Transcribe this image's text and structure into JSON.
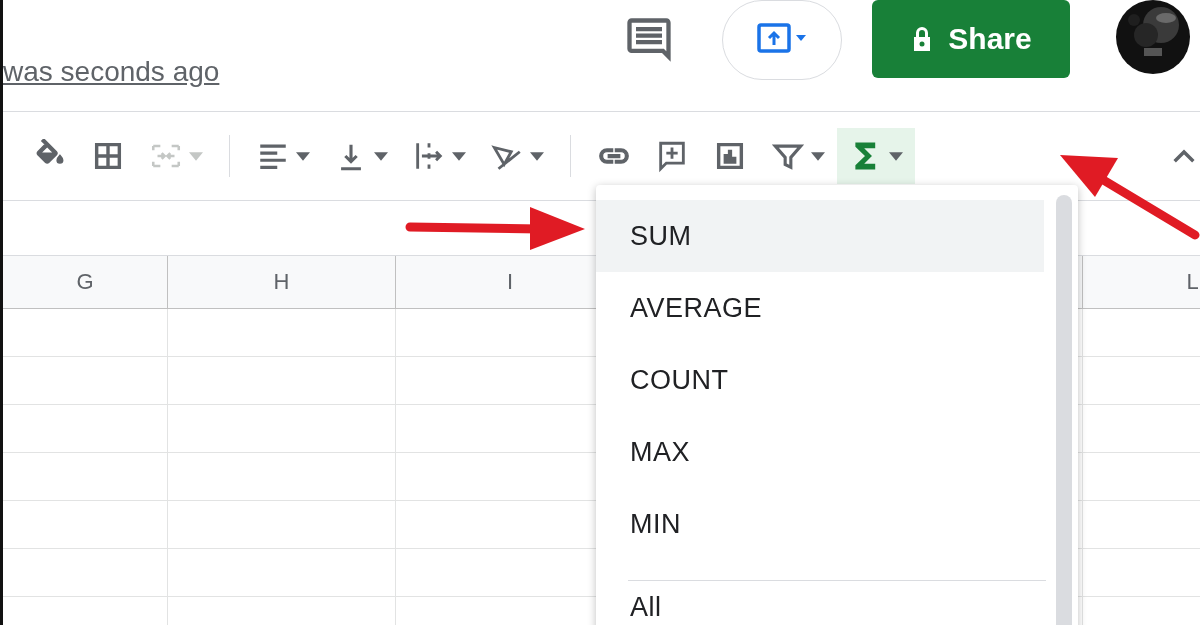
{
  "doc_status": "was seconds ago",
  "header": {
    "share_label": "Share"
  },
  "toolbar": [
    {
      "kind": "fill",
      "has_menu": false,
      "disabled": false,
      "active": false
    },
    {
      "kind": "borders",
      "has_menu": false,
      "disabled": false,
      "active": false
    },
    {
      "kind": "merge",
      "has_menu": true,
      "disabled": true,
      "active": false
    },
    {
      "kind": "separator"
    },
    {
      "kind": "halign",
      "has_menu": true,
      "disabled": false,
      "active": false
    },
    {
      "kind": "valign",
      "has_menu": true,
      "disabled": false,
      "active": false
    },
    {
      "kind": "wrap",
      "has_menu": true,
      "disabled": false,
      "active": false
    },
    {
      "kind": "rotate",
      "has_menu": true,
      "disabled": false,
      "active": false
    },
    {
      "kind": "separator"
    },
    {
      "kind": "link",
      "has_menu": false,
      "disabled": false,
      "active": false
    },
    {
      "kind": "comment",
      "has_menu": false,
      "disabled": false,
      "active": false
    },
    {
      "kind": "chart",
      "has_menu": false,
      "disabled": false,
      "active": false
    },
    {
      "kind": "filter",
      "has_menu": true,
      "disabled": false,
      "active": false
    },
    {
      "kind": "functions",
      "has_menu": true,
      "disabled": false,
      "active": true
    }
  ],
  "columns": [
    {
      "label": "G"
    },
    {
      "label": "H"
    },
    {
      "label": "I"
    },
    {},
    {},
    {
      "label": "L"
    }
  ],
  "function_menu": {
    "items": [
      {
        "label": "SUM",
        "selected": true
      },
      {
        "label": "AVERAGE",
        "selected": false
      },
      {
        "label": "COUNT",
        "selected": false
      },
      {
        "label": "MAX",
        "selected": false
      },
      {
        "label": "MIN",
        "selected": false
      }
    ],
    "more_items": [
      {
        "label": "All",
        "selected": false
      }
    ]
  }
}
